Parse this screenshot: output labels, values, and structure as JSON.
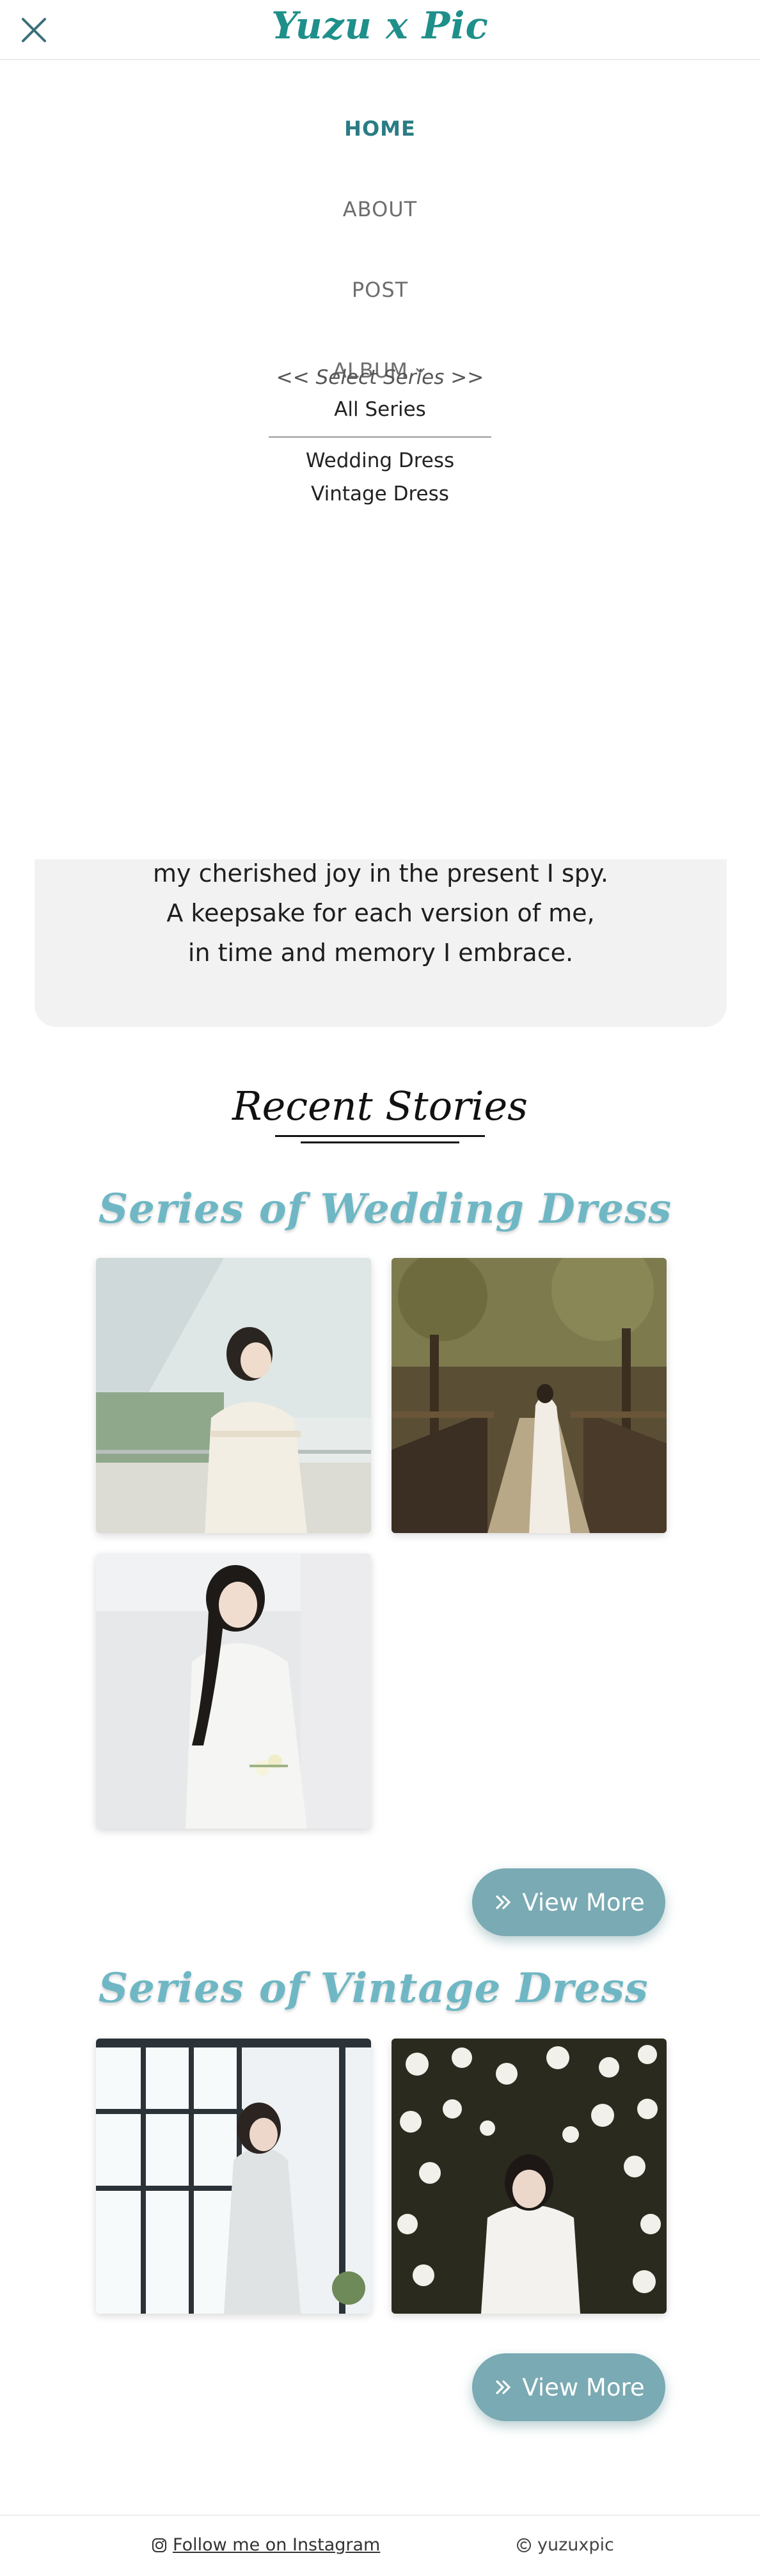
{
  "header": {
    "brand": "Yuzu x Pic",
    "close_icon": "close-icon"
  },
  "menu": {
    "items": [
      {
        "label": "HOME",
        "active": true
      },
      {
        "label": "ABOUT",
        "active": false
      },
      {
        "label": "POST",
        "active": false
      },
      {
        "label": "ALBUM",
        "active": false,
        "icon": "chevron-down-icon"
      }
    ],
    "select_hint": "<< Select Series >>",
    "series_options": [
      "All Series",
      "Wedding Dress",
      "Vintage Dress"
    ]
  },
  "poem": {
    "lines": [
      "my cherished joy in the present I spy.",
      "A keepsake for each version of me,",
      "in time and memory I embrace."
    ]
  },
  "recent": {
    "title": "Recent Stories",
    "series": [
      {
        "title": "Series of Wedding Dress",
        "photo_count": 3,
        "view_more": "View More"
      },
      {
        "title": "Series of Vintage Dress",
        "photo_count": 2,
        "view_more": "View More"
      }
    ]
  },
  "footer": {
    "instagram": "Follow me on Instagram",
    "copyright": "yuzuxpic"
  },
  "colors": {
    "brand": "#1f8f8a",
    "series_title": "#6fb7c4",
    "button": "#7aaab3",
    "active_menu": "#2b7c84"
  }
}
